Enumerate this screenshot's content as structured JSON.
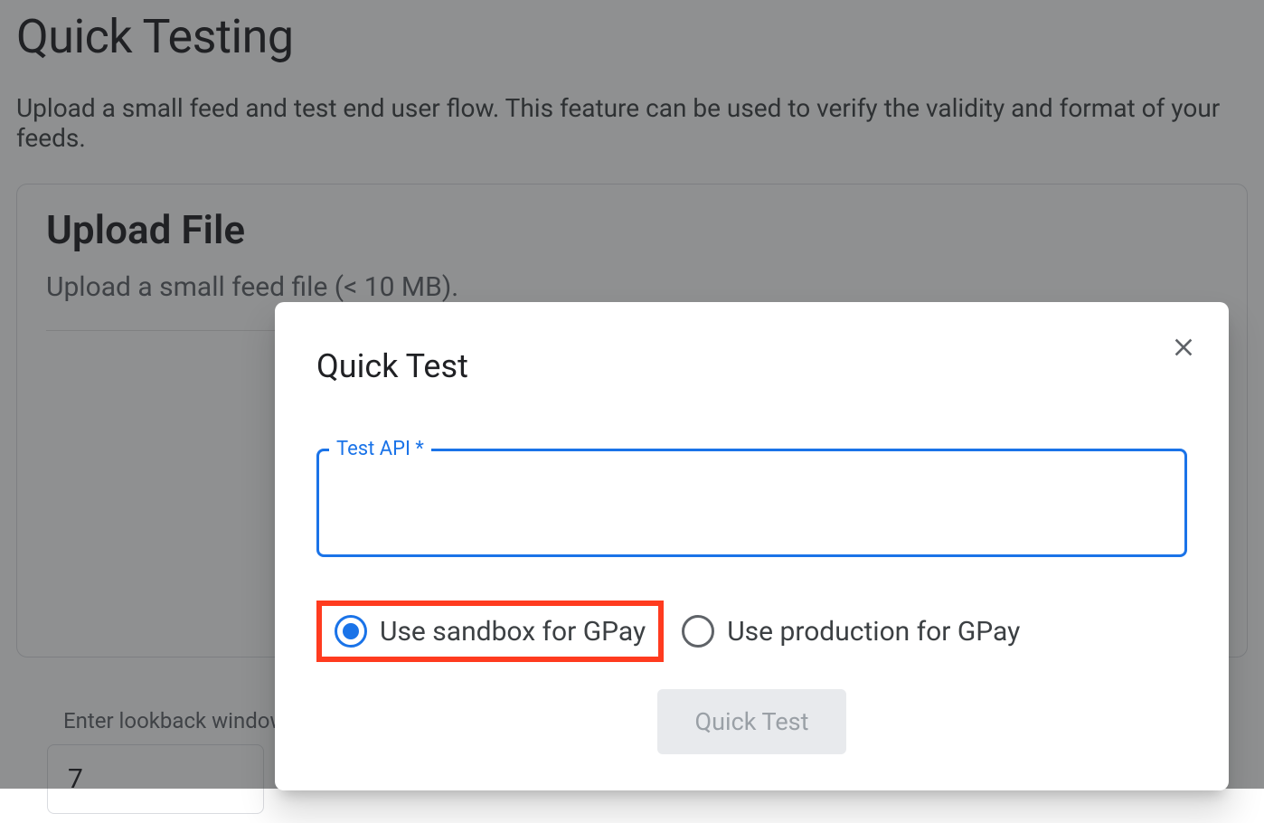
{
  "page": {
    "title": "Quick Testing",
    "subtitle": "Upload a small feed and test end user flow. This feature can be used to verify the validity and format of your feeds."
  },
  "card": {
    "title": "Upload File",
    "subtitle": "Upload a small feed file (< 10 MB)."
  },
  "lookback": {
    "label": "Enter lookback window",
    "value": "7"
  },
  "dialog": {
    "title": "Quick Test",
    "fieldLabel": "Test API *",
    "fieldValue": "",
    "radio1": "Use sandbox for GPay",
    "radio2": "Use production for GPay",
    "submitLabel": "Quick Test"
  }
}
